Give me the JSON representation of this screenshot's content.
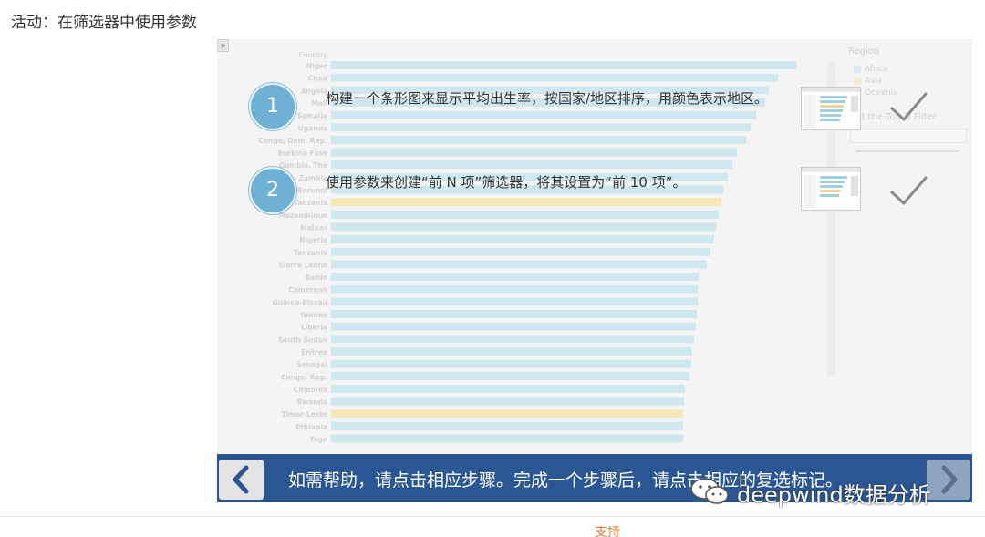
{
  "page": {
    "title": "活动：在筛选器中使用参数"
  },
  "chart_data": {
    "type": "bar",
    "orientation": "horizontal",
    "xlabel": "",
    "ylabel": "Country",
    "categories": [
      "Niger",
      "Chad",
      "Angola",
      "Mali",
      "Somalia",
      "Uganda",
      "Congo, Dem. Rep.",
      "Burkina Faso",
      "Gambia, The",
      "Zambia",
      "Burundi",
      "Tanzania",
      "Mozambique",
      "Malawi",
      "Nigeria",
      "Tanzania",
      "Sierra Leone",
      "Benin",
      "Cameroon",
      "Guinea-Bissau",
      "Guinea",
      "Liberia",
      "South Sudan",
      "Eritrea",
      "Senegal",
      "Congo, Rep.",
      "Comoros",
      "Rwanda",
      "Timor-Leste",
      "Ethiopia",
      "Togo"
    ],
    "values": [
      51,
      49,
      48,
      47.6,
      46.6,
      46,
      45.5,
      44.5,
      44,
      43.5,
      43,
      42.8,
      42.5,
      42.2,
      42,
      41.6,
      41.2,
      40.3,
      40.2,
      40.2,
      40.1,
      40,
      39.8,
      39.6,
      39.5,
      39.3,
      38.8,
      38.7,
      38.6,
      38.6,
      38.6
    ],
    "regions": [
      "Africa",
      "Africa",
      "Africa",
      "Africa",
      "Africa",
      "Africa",
      "Africa",
      "Africa",
      "Africa",
      "Africa",
      "Africa",
      "Asia",
      "Africa",
      "Africa",
      "Africa",
      "Africa",
      "Africa",
      "Africa",
      "Africa",
      "Africa",
      "Africa",
      "Africa",
      "Africa",
      "Africa",
      "Africa",
      "Africa",
      "Africa",
      "Africa",
      "Asia",
      "Africa",
      "Africa"
    ],
    "xlim": [
      0,
      52
    ],
    "legend": {
      "title": "Region",
      "placement": "right",
      "items": [
        "Africa",
        "Asia",
        "Oceania"
      ]
    }
  },
  "colors": {
    "Africa": "#cfe8ef",
    "Asia": "#f6e7bb",
    "Oceania": "#f3d9c9",
    "nav_bar": "#2a5794",
    "circle": "#6fb1d4"
  },
  "panel": {
    "filter_label": "Set the Top N Filter"
  },
  "steps": [
    {
      "number": "1",
      "text": "构建一个条形图来显示平均出生率，按国家/地区排序，用颜色表示地区。",
      "check_icon": "checkmark-icon"
    },
    {
      "number": "2",
      "text": "使用参数来创建“前 N 项”筛选器，将其设置为“前 10 项”。",
      "check_icon": "checkmark-icon"
    }
  ],
  "nav": {
    "message": "如需帮助，请点击相应步骤。完成一个步骤后，请点击相应的复选标记。",
    "prev_icon": "chevron-left-icon",
    "next_icon": "chevron-right-icon"
  },
  "watermark": {
    "text": "deepwind数据分析"
  },
  "footer": {
    "link": "支持"
  }
}
